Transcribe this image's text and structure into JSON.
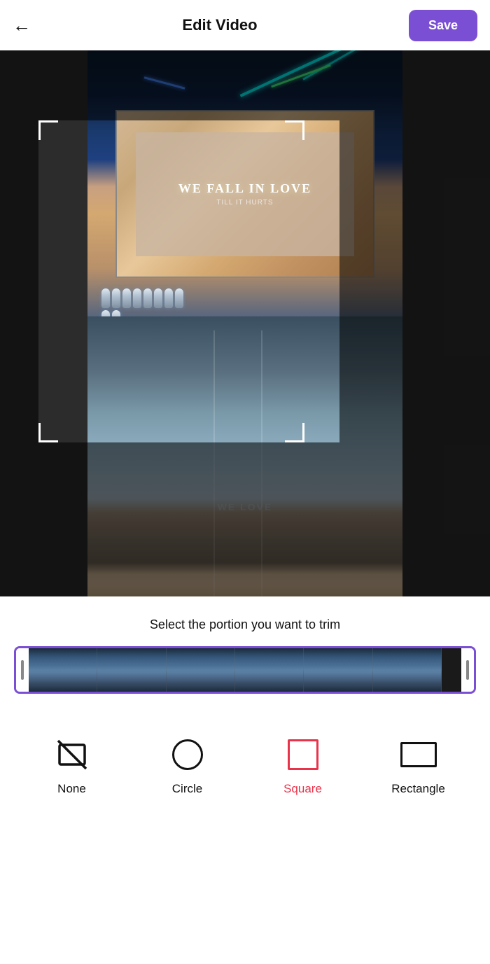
{
  "header": {
    "back_label": "←",
    "title": "Edit Video",
    "save_label": "Save"
  },
  "video": {
    "screen_text1": "WE FALL IN LOVE",
    "screen_text2": "TILL IT HURTS",
    "reflection_text": "WE LOVE"
  },
  "timeline": {
    "trim_label": "Select the portion you want to trim"
  },
  "shapes": {
    "none_label": "None",
    "circle_label": "Circle",
    "square_label": "Square",
    "rectangle_label": "Rectangle",
    "active": "square"
  },
  "colors": {
    "accent": "#7B4FD4",
    "active_shape": "#e8334a"
  }
}
